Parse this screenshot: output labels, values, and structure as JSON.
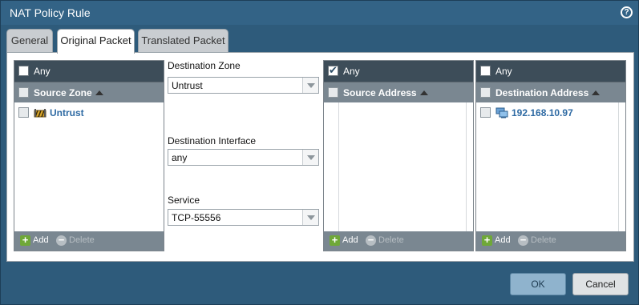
{
  "window": {
    "title": "NAT Policy Rule",
    "help_icon": "?"
  },
  "tabs": [
    {
      "label": "General"
    },
    {
      "label": "Original Packet"
    },
    {
      "label": "Translated Packet"
    }
  ],
  "source_zone_panel": {
    "any_label": "Any",
    "any_checked": false,
    "column": "Source Zone",
    "rows": [
      {
        "label": "Untrust",
        "icon": "zone-icon"
      }
    ],
    "add_label": "Add",
    "delete_label": "Delete"
  },
  "middle": {
    "destination_zone": {
      "label": "Destination Zone",
      "value": "Untrust"
    },
    "destination_interface": {
      "label": "Destination Interface",
      "value": "any"
    },
    "service": {
      "label": "Service",
      "value": "TCP-55556"
    }
  },
  "source_address_panel": {
    "any_label": "Any",
    "any_checked": true,
    "column": "Source Address",
    "add_label": "Add",
    "delete_label": "Delete"
  },
  "destination_address_panel": {
    "any_label": "Any",
    "any_checked": false,
    "column": "Destination Address",
    "rows": [
      {
        "label": "192.168.10.97",
        "icon": "address-object-icon"
      }
    ],
    "add_label": "Add",
    "delete_label": "Delete"
  },
  "buttons": {
    "ok": "OK",
    "cancel": "Cancel"
  }
}
